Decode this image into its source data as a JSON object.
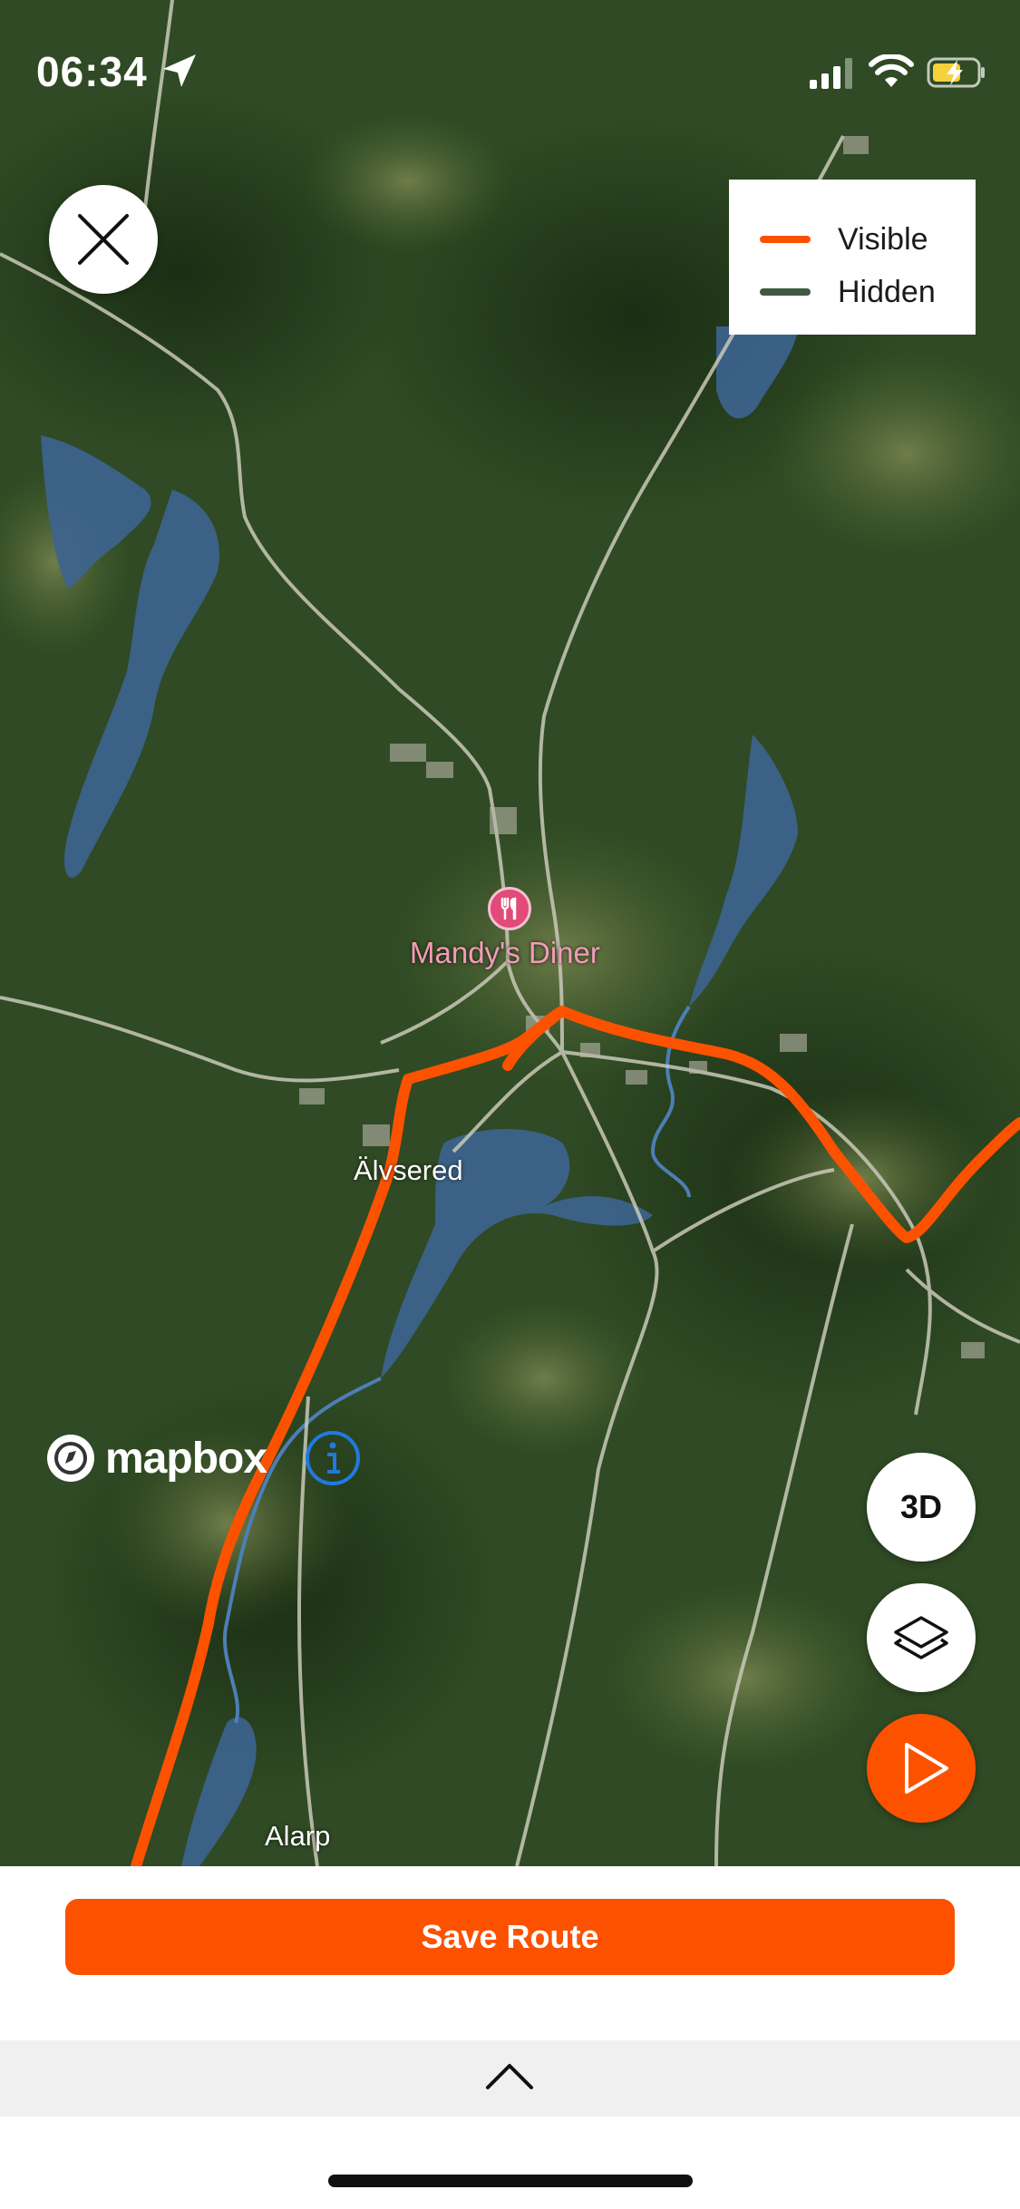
{
  "status_bar": {
    "time": "06:34"
  },
  "legend": {
    "items": [
      {
        "label": "Visible",
        "color": "#fc5200"
      },
      {
        "label": "Hidden",
        "color": "#3f5a40"
      }
    ]
  },
  "map": {
    "poi": {
      "name": "Mandy's Diner",
      "icon": "restaurant-icon"
    },
    "place_labels": [
      "Älvsered",
      "Alarp"
    ],
    "attribution": "mapbox",
    "route_color": "#fc5200"
  },
  "controls": {
    "three_d_label": "3D",
    "layers_icon": "layers-icon",
    "play_icon": "play-icon",
    "close_icon": "close-icon"
  },
  "footer": {
    "save_label": "Save Route",
    "expand_icon": "chevron-up-icon"
  }
}
